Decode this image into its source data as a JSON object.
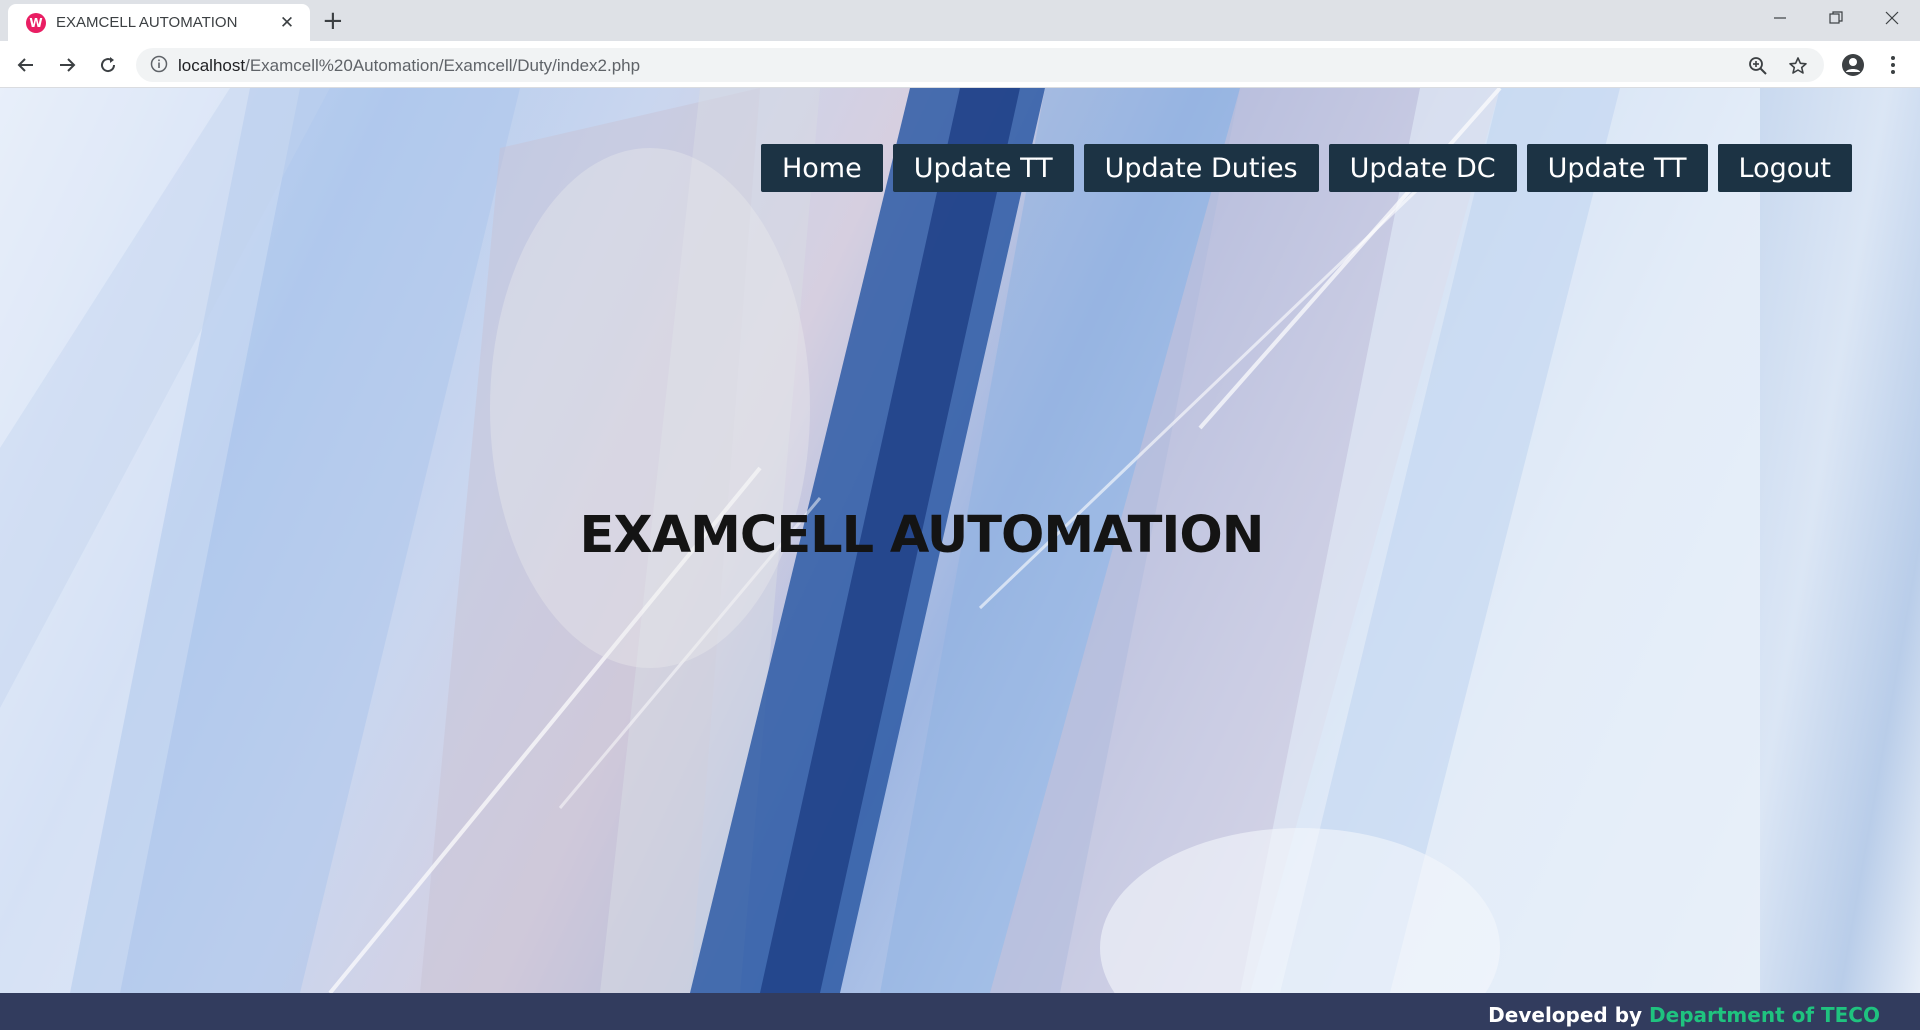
{
  "browser": {
    "tab_title": "EXAMCELL AUTOMATION",
    "favicon_letter": "W",
    "url_host": "localhost",
    "url_path": "/Examcell%20Automation/Examcell/Duty/index2.php"
  },
  "nav": {
    "items": [
      {
        "label": "Home"
      },
      {
        "label": "Update TT"
      },
      {
        "label": "Update Duties"
      },
      {
        "label": "Update DC"
      },
      {
        "label": "Update TT"
      },
      {
        "label": "Logout"
      }
    ]
  },
  "hero": {
    "title": "EXAMCELL AUTOMATION"
  },
  "footer": {
    "prefix": "Developed by",
    "department": "Department of TECO"
  },
  "colors": {
    "nav_bg": "#1c3344",
    "footer_bg": "#323c5e",
    "footer_accent": "#1fc37f",
    "favicon": "#e91e63"
  }
}
